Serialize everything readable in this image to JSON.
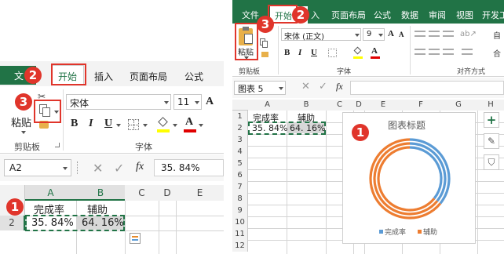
{
  "left": {
    "tabs": {
      "file_partial": "文",
      "home": "开始",
      "insert": "插入",
      "page_layout": "页面布局",
      "formulas": "公式"
    },
    "clipboard": {
      "paste": "粘贴",
      "group": "剪贴板"
    },
    "font": {
      "name": "宋体",
      "size": "11",
      "group": "字体",
      "bold": "B",
      "italic": "I",
      "underline": "U",
      "font_color": "A",
      "grow_font": "A"
    },
    "formula_bar": {
      "name_box": "A2",
      "cancel": "✕",
      "enter": "✓",
      "fx": "fx",
      "value": "35. 84%"
    },
    "columns": [
      "A",
      "B",
      "C",
      "D",
      "E"
    ],
    "rows": [
      "1",
      "2"
    ],
    "cells": {
      "a1": "完成率",
      "b1": "辅助",
      "a2": "35. 84%",
      "b2": "64. 16%"
    }
  },
  "right": {
    "tabs": {
      "file": "文件",
      "home": "开始",
      "insert_partial": "入",
      "page_layout": "页面布局",
      "formulas": "公式",
      "data": "数据",
      "review": "审阅",
      "view": "视图",
      "developer_partial": "开发工"
    },
    "clipboard": {
      "paste": "粘贴",
      "group": "剪贴板"
    },
    "font": {
      "name": "宋体 (正文)",
      "size": "9",
      "group": "字体",
      "bold": "B",
      "italic": "I",
      "underline": "U",
      "font_color": "A",
      "grow_font": "A",
      "shrink_font": "A"
    },
    "alignment": {
      "group": "对齐方式",
      "wrap_partial": "自",
      "merge_partial": "合"
    },
    "formula_bar": {
      "name_box": "图表 5",
      "cancel": "✕",
      "enter": "✓",
      "fx": "fx"
    },
    "columns": [
      "A",
      "B",
      "C",
      "D",
      "E",
      "F",
      "G",
      "H"
    ],
    "rows": [
      "1",
      "2",
      "3",
      "4",
      "5",
      "6",
      "7",
      "8",
      "9",
      "10",
      "11",
      "12"
    ],
    "cells": {
      "a1": "完成率",
      "b1": "辅助",
      "a2": "35. 84%",
      "b2": "64. 16%"
    },
    "chart_side_buttons": {
      "add": "+",
      "style": "✎",
      "filter": "⛉"
    }
  },
  "callouts": {
    "left": [
      "1",
      "2",
      "3"
    ],
    "right": [
      "1",
      "2",
      "3"
    ]
  },
  "chart_data": {
    "type": "pie",
    "subtype": "doughnut",
    "title": "图表标题",
    "categories": [
      "完成率",
      "辅助"
    ],
    "series": [
      {
        "values": [
          35.84,
          64.16
        ]
      },
      {
        "values": [
          35.84,
          64.16
        ]
      },
      {
        "values": [
          35.84,
          64.16
        ]
      }
    ],
    "colors": [
      "#5b9bd5",
      "#ed7d31"
    ],
    "legend": [
      "完成率",
      "辅助"
    ],
    "legend_position": "bottom"
  },
  "colors": {
    "callout": "#e0352b",
    "accent_green": "#217346",
    "series_blue": "#5b9bd5",
    "series_orange": "#ed7d31"
  }
}
